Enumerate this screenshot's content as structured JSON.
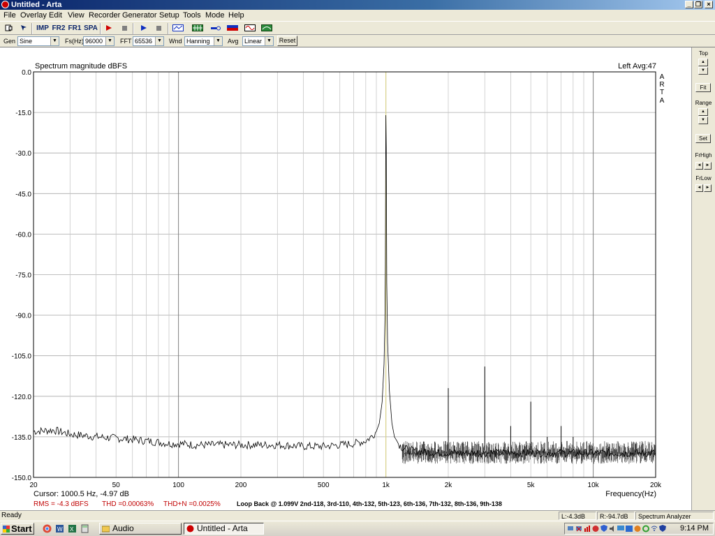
{
  "window": {
    "title": "Untitled - Arta"
  },
  "menu": [
    "File",
    "Overlay",
    "Edit",
    "View",
    "Recorder",
    "Generator",
    "Setup",
    "Tools",
    "Mode",
    "Help"
  ],
  "toolbar": {
    "imp": "IMP",
    "fr2": "FR2",
    "fr1": "FR1",
    "spa": "SPA"
  },
  "controls": {
    "gen_label": "Gen",
    "gen_value": "Sine",
    "fs_label": "Fs(Hz)",
    "fs_value": "96000",
    "fft_label": "FFT",
    "fft_value": "65536",
    "wnd_label": "Wnd",
    "wnd_value": "Hanning",
    "avg_label": "Avg",
    "avg_value": "Linear",
    "reset": "Reset"
  },
  "side_panel": {
    "top": "Top",
    "fit": "Fit",
    "range": "Range",
    "set": "Set",
    "frhigh": "FrHigh",
    "frlow": "FrLow"
  },
  "plot": {
    "title": "Spectrum magnitude dBFS",
    "channel": "Left  Avg:47",
    "brand_letters": [
      "A",
      "R",
      "T",
      "A"
    ],
    "xlabel": "Frequency(Hz)",
    "cursor": "Cursor:  1000.5 Hz, -4.97 dB",
    "rms": "RMS =   -4.3 dBFS",
    "thd": "THD =0.00063%",
    "thdn": "THD+N =0.0025%",
    "note": "Loop Back @ 1.099V 2nd-118, 3rd-110, 4th-132, 5th-123, 6th-136, 7th-132, 8th-136, 9th-138"
  },
  "chart_data": {
    "type": "line",
    "title": "Spectrum magnitude dBFS",
    "xlabel": "Frequency(Hz)",
    "ylabel": "",
    "xscale": "log",
    "xlim": [
      20,
      20000
    ],
    "ylim": [
      -150,
      0
    ],
    "grid": true,
    "x_ticks": [
      {
        "v": 20,
        "l": "20"
      },
      {
        "v": 50,
        "l": "50"
      },
      {
        "v": 100,
        "l": "100"
      },
      {
        "v": 200,
        "l": "200"
      },
      {
        "v": 500,
        "l": "500"
      },
      {
        "v": 1000,
        "l": "1k"
      },
      {
        "v": 2000,
        "l": "2k"
      },
      {
        "v": 5000,
        "l": "5k"
      },
      {
        "v": 10000,
        "l": "10k"
      },
      {
        "v": 20000,
        "l": "20k"
      }
    ],
    "y_ticks": [
      {
        "v": 0,
        "l": "0.0"
      },
      {
        "v": -15,
        "l": "-15.0"
      },
      {
        "v": -30,
        "l": "-30.0"
      },
      {
        "v": -45,
        "l": "-45.0"
      },
      {
        "v": -60,
        "l": "-60.0"
      },
      {
        "v": -75,
        "l": "-75.0"
      },
      {
        "v": -90,
        "l": "-90.0"
      },
      {
        "v": -105,
        "l": "-105.0"
      },
      {
        "v": -120,
        "l": "-120.0"
      },
      {
        "v": -135,
        "l": "-135.0"
      },
      {
        "v": -150,
        "l": "-150.0"
      }
    ],
    "cursor_x": 1000.5,
    "series": [
      {
        "x": [
          20,
          25,
          30,
          35,
          40,
          50,
          60,
          70,
          80,
          90,
          100,
          120,
          150,
          200,
          250,
          300,
          400,
          500,
          600,
          700,
          800,
          850,
          900,
          930,
          960,
          980,
          990,
          995,
          1000,
          1005,
          1010,
          1020,
          1040,
          1070,
          1100,
          1150,
          1200,
          1300,
          1500,
          1800,
          2000,
          2500,
          3000,
          3500,
          4000,
          5000,
          6000,
          7000,
          8000,
          10000,
          12000,
          15000,
          20000
        ],
        "y": [
          -133,
          -132.5,
          -134,
          -134.5,
          -135,
          -135.5,
          -136,
          -136.5,
          -137,
          -137.5,
          -137.5,
          -138,
          -138,
          -138,
          -138,
          -138,
          -138.5,
          -138.5,
          -138,
          -137.5,
          -136.5,
          -135,
          -133,
          -130,
          -122,
          -108,
          -92,
          -72,
          -16,
          -28,
          -78,
          -100,
          -118,
          -130,
          -135,
          -137.5,
          -139,
          -140,
          -140.5,
          -141,
          -141,
          -141,
          -141,
          -141,
          -141,
          -141,
          -141,
          -141,
          -141,
          -141,
          -141,
          -141,
          -141
        ]
      }
    ],
    "harmonics": [
      {
        "x": 2000,
        "y": -117
      },
      {
        "x": 3000,
        "y": -109
      },
      {
        "x": 4000,
        "y": -131
      },
      {
        "x": 5000,
        "y": -122
      },
      {
        "x": 6000,
        "y": -135
      },
      {
        "x": 7000,
        "y": -131
      },
      {
        "x": 8000,
        "y": -135
      },
      {
        "x": 9000,
        "y": -137
      }
    ],
    "noise_band": {
      "from": 1200,
      "to": 20000,
      "spread_db": 5
    }
  },
  "status": {
    "ready": "Ready",
    "left": "L:-4.3dB",
    "right": "R:-94.7dB",
    "mode": "Spectrum Analyzer"
  },
  "taskbar": {
    "start": "Start",
    "tasks": [
      "Audio",
      "Untitled - Arta"
    ],
    "clock": "9:14 PM"
  },
  "colors": {
    "trace": "#000000",
    "cursor": "#e8e08a",
    "grid": "#a8a8a8",
    "rms_text": "#c00000",
    "title_gradient_start": "#0a246a"
  }
}
